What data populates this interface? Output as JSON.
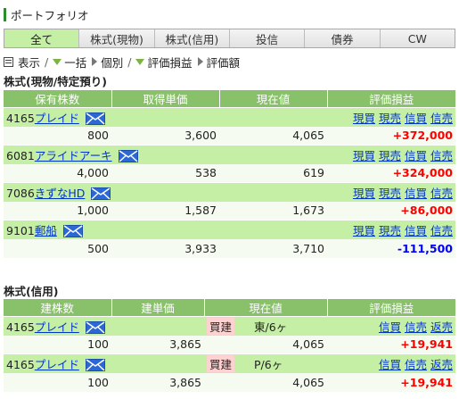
{
  "header": {
    "title": "ポートフォリオ"
  },
  "tabs": [
    "全て",
    "株式(現物)",
    "株式(信用)",
    "投信",
    "債券",
    "CW"
  ],
  "toolbar": {
    "display_label": "表示",
    "slash": "/",
    "bulk_label": "一括",
    "individual_label": "個別",
    "unrealized_label": "評価損益",
    "valuation_label": "評価額"
  },
  "cash_section": {
    "title": "株式(現物/特定預り)",
    "headers": [
      "保有株数",
      "取得単価",
      "現在値",
      "評価損益"
    ],
    "actions": [
      "現買",
      "現売",
      "信買",
      "信売"
    ],
    "rows": [
      {
        "code": "4165",
        "name": "プレイド",
        "shares": "800",
        "cost": "3,600",
        "price": "4,065",
        "pl": "+372,000",
        "pl_sign": "gain"
      },
      {
        "code": "6081",
        "name": "アライドアーキ",
        "shares": "4,000",
        "cost": "538",
        "price": "619",
        "pl": "+324,000",
        "pl_sign": "gain"
      },
      {
        "code": "7086",
        "name": "きずなHD",
        "shares": "1,000",
        "cost": "1,587",
        "price": "1,673",
        "pl": "+86,000",
        "pl_sign": "gain"
      },
      {
        "code": "9101",
        "name": "郵船",
        "shares": "500",
        "cost": "3,933",
        "price": "3,710",
        "pl": "-111,500",
        "pl_sign": "loss"
      }
    ]
  },
  "margin_section": {
    "title": "株式(信用)",
    "headers": [
      "建株数",
      "建単価",
      "現在値",
      "評価損益"
    ],
    "actions": [
      "信買",
      "信売",
      "返売"
    ],
    "rows": [
      {
        "code": "4165",
        "name": "プレイド",
        "position": "買建",
        "term": "東/6ヶ",
        "shares": "100",
        "cost": "3,865",
        "price": "4,065",
        "pl": "+19,941"
      },
      {
        "code": "4165",
        "name": "プレイド",
        "position": "買建",
        "term": "P/6ヶ",
        "shares": "100",
        "cost": "3,865",
        "price": "4,065",
        "pl": "+19,941"
      }
    ]
  },
  "colors": {
    "header_green": "#88c16a",
    "row_green": "#c6efa6",
    "gain": "#ff0000",
    "loss": "#0000ff",
    "link": "#0033cc"
  }
}
